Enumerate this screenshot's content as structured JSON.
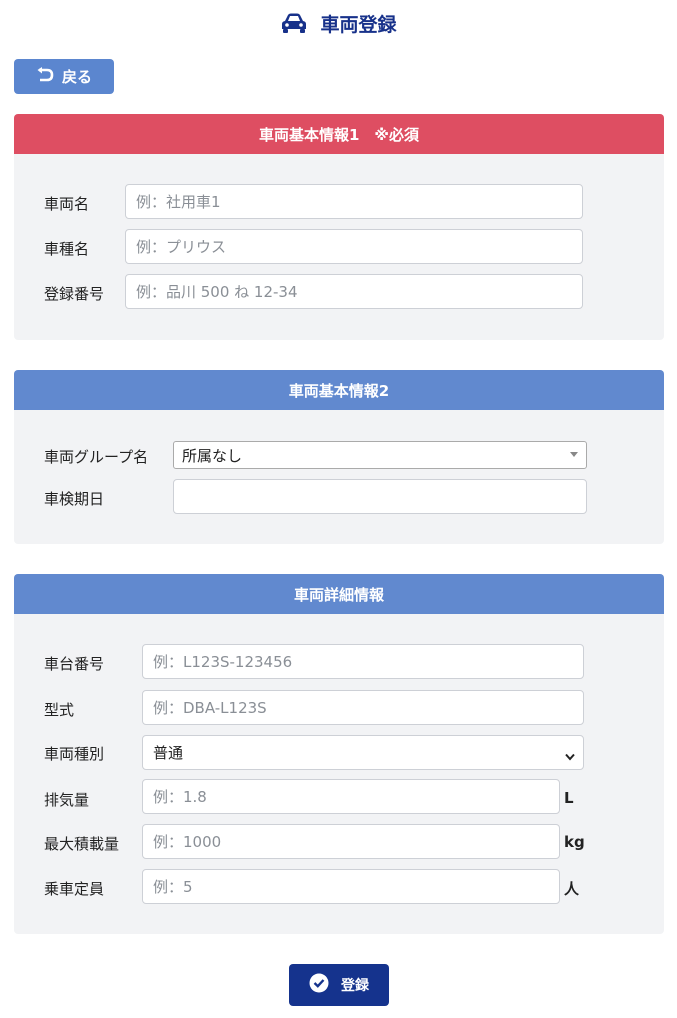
{
  "header": {
    "title": "車両登録",
    "icon": "car-icon"
  },
  "back_button": {
    "label": "戻る",
    "icon": "return-arrow-icon"
  },
  "section1": {
    "title": "車両基本情報1　※必須",
    "fields": {
      "vehicle_name": {
        "label": "車両名",
        "placeholder": "例：社用車1"
      },
      "car_model": {
        "label": "車種名",
        "placeholder": "例：プリウス"
      },
      "registration_number": {
        "label": "登録番号",
        "placeholder": "例：品川 500 ね 12-34"
      }
    }
  },
  "section2": {
    "title": "車両基本情報2",
    "fields": {
      "vehicle_group": {
        "label": "車両グループ名",
        "value": "所属なし"
      },
      "inspection_date": {
        "label": "車検期日",
        "value": ""
      }
    }
  },
  "section3": {
    "title": "車両詳細情報",
    "fields": {
      "chassis_number": {
        "label": "車台番号",
        "placeholder": "例：L123S-123456"
      },
      "model_code": {
        "label": "型式",
        "placeholder": "例：DBA-L123S"
      },
      "vehicle_type": {
        "label": "車両種別",
        "value": "普通"
      },
      "displacement": {
        "label": "排気量",
        "placeholder": "例：1.8",
        "unit": "L"
      },
      "max_load": {
        "label": "最大積載量",
        "placeholder": "例：1000",
        "unit": "kg"
      },
      "capacity": {
        "label": "乗車定員",
        "placeholder": "例：5",
        "unit": "人"
      }
    }
  },
  "submit_button": {
    "label": "登録",
    "icon": "check-circle-icon"
  },
  "colors": {
    "primary_dark": "#15338d",
    "header_blue": "#6189cf",
    "required_red": "#de4e62",
    "back_button": "#5b86cf"
  }
}
